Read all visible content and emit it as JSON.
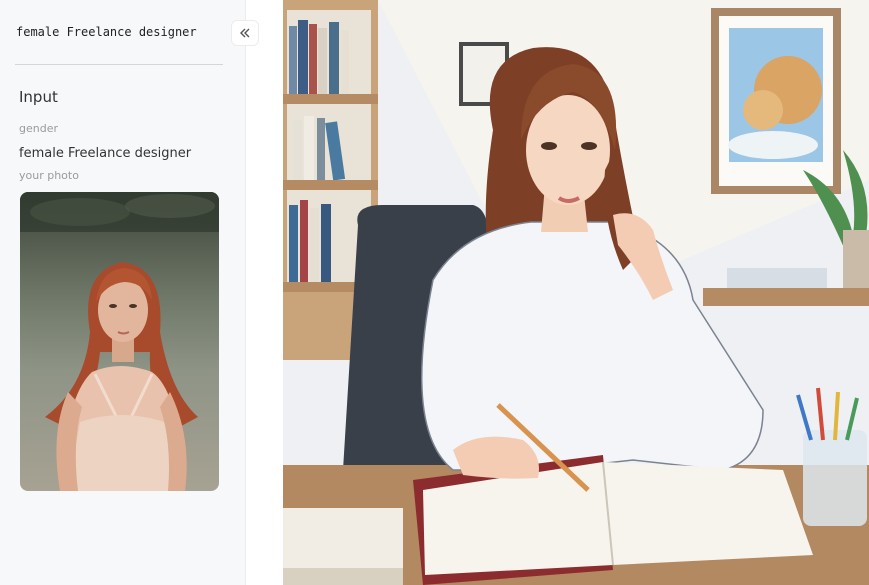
{
  "sidebar": {
    "prompt_title": "female Freelance designer",
    "input_heading": "Input",
    "fields": {
      "gender_label": "gender",
      "gender_value": "female Freelance designer",
      "photo_label": "your photo"
    },
    "collapse_icon": "double-chevron-left-icon"
  },
  "images": {
    "input_photo": "woman with red hair sitting outdoors in a field",
    "generated_result": "illustration of a woman in a white shirt writing in a notebook at a desk"
  },
  "colors": {
    "sidebar_bg": "#f7f8fa",
    "text": "#333333",
    "muted": "#9a9aa0"
  }
}
